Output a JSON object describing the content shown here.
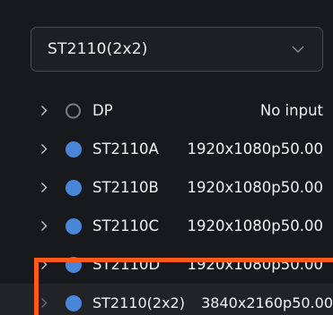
{
  "dropdown": {
    "value": "ST2110(2x2)"
  },
  "sources": [
    {
      "name": "DP",
      "format": "No input",
      "status": "inactive"
    },
    {
      "name": "ST2110A",
      "format": "1920x1080p50.00",
      "status": "active"
    },
    {
      "name": "ST2110B",
      "format": "1920x1080p50.00",
      "status": "active"
    },
    {
      "name": "ST2110C",
      "format": "1920x1080p50.00",
      "status": "active"
    },
    {
      "name": "ST2110D",
      "format": "1920x1080p50.00",
      "status": "active"
    },
    {
      "name": "ST2110(2x2)",
      "format": "3840x2160p50.00",
      "status": "active",
      "selected": true
    }
  ],
  "colors": {
    "background": "#17191c",
    "active_dot": "#4a86d8",
    "highlight": "#ff5a1a"
  },
  "icons": {
    "dropdown": "chevron-down-icon",
    "expand": "chevron-right-icon"
  }
}
